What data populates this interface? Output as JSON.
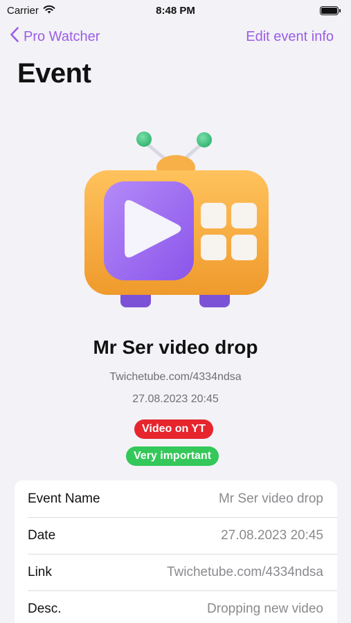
{
  "status_bar": {
    "carrier": "Carrier",
    "time": "8:48 PM"
  },
  "nav": {
    "back_label": "Pro Watcher",
    "edit_label": "Edit event info"
  },
  "page": {
    "title": "Event"
  },
  "event": {
    "name": "Mr Ser video drop",
    "link": "Twichetube.com/4334ndsa",
    "datetime": "27.08.2023 20:45",
    "tags": [
      {
        "label": "Video on YT",
        "color": "#e6252d"
      },
      {
        "label": "Very important",
        "color": "#34c759"
      }
    ]
  },
  "details": [
    {
      "label": "Event Name",
      "value": "Mr Ser video drop"
    },
    {
      "label": "Date",
      "value": "27.08.2023 20:45"
    },
    {
      "label": "Link",
      "value": "Twichetube.com/4334ndsa"
    },
    {
      "label": "Desc.",
      "value": "Dropping new video"
    }
  ],
  "colors": {
    "accent": "#9b5de5",
    "background": "#f2f2f7",
    "tv_body": "#f4a73b",
    "tv_screen": "#9d6cf0",
    "antenna_ball": "#3fc483"
  },
  "icons": {
    "signal": "wifi-icon",
    "battery": "battery-icon",
    "back": "chevron-left-icon",
    "hero": "tv-illustration"
  }
}
